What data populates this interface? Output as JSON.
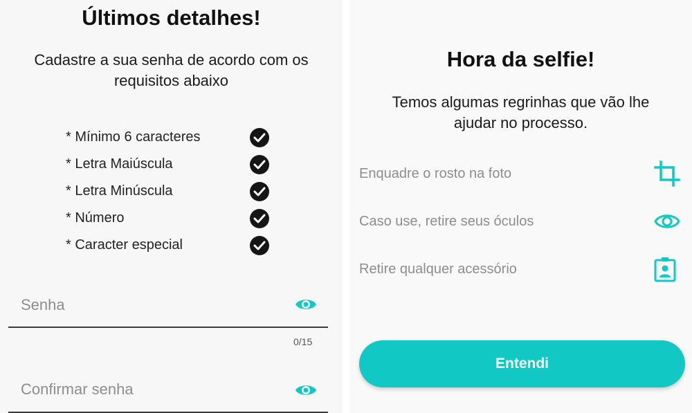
{
  "password_screen": {
    "title": "Últimos detalhes!",
    "subtitle_line1": "Cadastre a sua senha de acordo com os",
    "subtitle_line2": "requisitos abaixo",
    "requirements": [
      {
        "label": "* Mínimo 6 caracteres",
        "met": true
      },
      {
        "label": "* Letra Maiúscula",
        "met": true
      },
      {
        "label": "* Letra Minúscula",
        "met": true
      },
      {
        "label": "* Número",
        "met": true
      },
      {
        "label": "* Caracter especial",
        "met": true
      }
    ],
    "password_field": {
      "placeholder": "Senha",
      "icon": "eye-icon",
      "counter": "0/15"
    },
    "confirm_field": {
      "placeholder": "Confirmar senha",
      "icon": "eye-icon"
    }
  },
  "selfie_screen": {
    "title": "Hora da selfie!",
    "subtitle_line1": "Temos algumas regrinhas que vão lhe",
    "subtitle_line2": "ajudar no processo.",
    "rules": [
      {
        "text": "Enquadre o rosto na foto",
        "icon": "crop-icon"
      },
      {
        "text": "Caso use, retire seus óculos",
        "icon": "eye-icon"
      },
      {
        "text": "Retire qualquer acessório",
        "icon": "id-badge-icon"
      }
    ],
    "button_label": "Entendi"
  },
  "colors": {
    "accent": "#12c8c4",
    "check_bg": "#151515",
    "placeholder": "#8d8d8d"
  }
}
